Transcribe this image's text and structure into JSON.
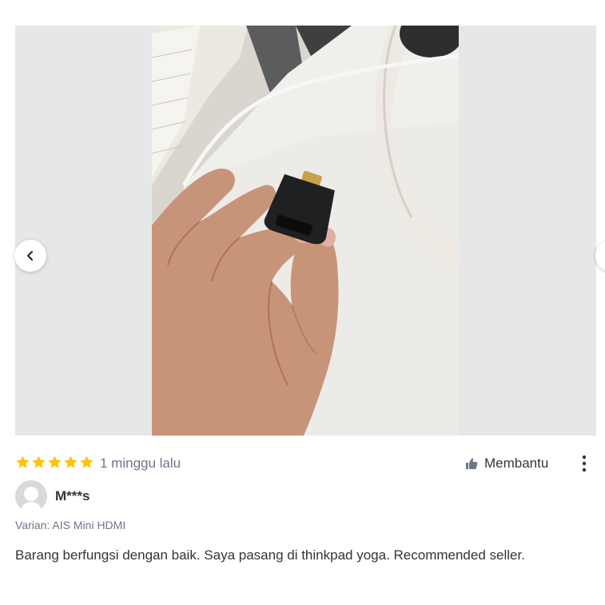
{
  "gallery": {
    "photo_description_icon": "product-photo",
    "prev_icon": "chevron-left-icon",
    "next_icon": "chevron-right-icon"
  },
  "review": {
    "rating": 5,
    "rating_max": 5,
    "time": "1 minggu lalu",
    "helpful_label": "Membantu",
    "reviewer_name": "M***s",
    "variant": "Varian: AIS Mini HDMI",
    "text": "Barang berfungsi dengan baik. Saya pasang di thinkpad yoga. Recommended seller."
  },
  "colors": {
    "star": "#ffc400",
    "muted_text": "#6d7588",
    "body_text": "#31353b",
    "gallery_bg": "#e6e7e9"
  }
}
